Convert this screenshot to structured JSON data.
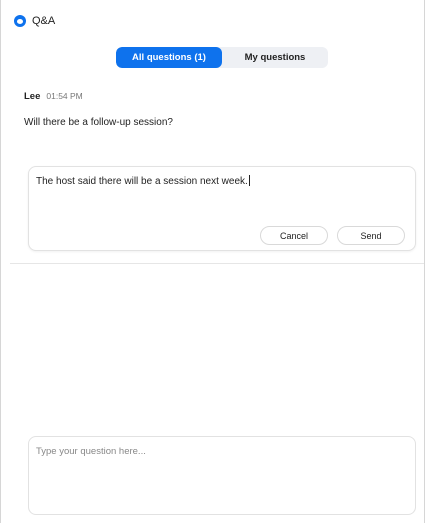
{
  "window": {
    "title": "Q&A",
    "accent": "#0e72ed"
  },
  "tabs": [
    {
      "label": "All questions (1)",
      "active": true
    },
    {
      "label": "My questions",
      "active": false
    }
  ],
  "question": {
    "author": "Lee",
    "time": "01:54 PM",
    "text": "Will there be a follow-up session?"
  },
  "answer": {
    "value": "The host said there will be a session next week.",
    "cancel_label": "Cancel",
    "send_label": "Send"
  },
  "ask": {
    "placeholder": "Type your question here..."
  }
}
